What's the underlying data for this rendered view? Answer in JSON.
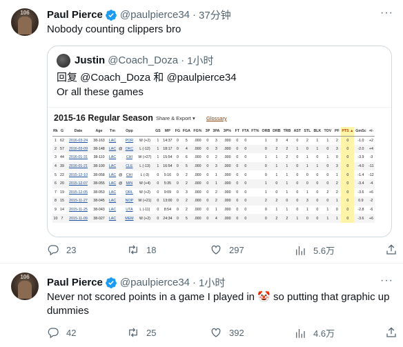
{
  "tweet1": {
    "avatar_text": "106",
    "name": "Paul Pierce",
    "handle": "@paulpierce34",
    "time": "37分钟",
    "text": "Nobody counting clippers bro",
    "quote": {
      "name": "Justin",
      "handle": "@Coach_Doza",
      "time": "1小时",
      "reply_line": "回复 @Coach_Doza 和 @paulpierce34",
      "text": "Or all these games",
      "image": {
        "title": "2015-16 Regular Season",
        "share_export": "Share & Export ▾",
        "glossary": "Glossary",
        "headers": [
          "Rk",
          "G",
          "Date",
          "Age",
          "Tm",
          "",
          "Opp",
          "",
          "GS",
          "MP",
          "FG",
          "FGA",
          "FG%",
          "3P",
          "3PA",
          "3P%",
          "FT",
          "FTA",
          "FT%",
          "ORB",
          "DRB",
          "TRB",
          "AST",
          "STL",
          "BLK",
          "TOV",
          "PF",
          "PTS ▲",
          "GmSc",
          "+/-"
        ],
        "rows": [
          [
            "1",
            "62",
            "2016-03-24",
            "38-163",
            "LAC",
            "",
            "POR",
            "W (+2)",
            "1",
            "14:37",
            "0",
            "5",
            ".000",
            "0",
            "3",
            ".000",
            "0",
            "0",
            "",
            "1",
            "3",
            "4",
            "0",
            "2",
            "1",
            "1",
            "2",
            "0",
            "-1.0",
            "+2"
          ],
          [
            "2",
            "57",
            "2016-03-09",
            "38-148",
            "LAC",
            "@",
            "OKC",
            "L (-12)",
            "1",
            "18:17",
            "0",
            "4",
            ".000",
            "0",
            "3",
            ".000",
            "0",
            "0",
            "",
            "0",
            "2",
            "2",
            "1",
            "0",
            "1",
            "0",
            "3",
            "0",
            "-2.0",
            "+4"
          ],
          [
            "3",
            "44",
            "2016-01-31",
            "38-110",
            "LAC",
            "",
            "CHI",
            "W (+27)",
            "1",
            "15:54",
            "0",
            "6",
            ".000",
            "0",
            "2",
            ".000",
            "0",
            "0",
            "",
            "1",
            "1",
            "2",
            "0",
            "1",
            "0",
            "1",
            "0",
            "0",
            "-3.9",
            "-3"
          ],
          [
            "4",
            "39",
            "2016-01-21",
            "38-100",
            "LAC",
            "",
            "CLE",
            "L (-13)",
            "1",
            "16:54",
            "0",
            "5",
            ".000",
            "0",
            "3",
            ".000",
            "0",
            "0",
            "",
            "0",
            "1",
            "1",
            "0",
            "1",
            "1",
            "0",
            "3",
            "0",
            "-4.0",
            "-11"
          ],
          [
            "5",
            "22",
            "2015-12-10",
            "38-058",
            "LAC",
            "@",
            "CHI",
            "L (-3)",
            "0",
            "5:16",
            "0",
            "2",
            ".000",
            "0",
            "1",
            ".000",
            "0",
            "0",
            "",
            "0",
            "1",
            "1",
            "0",
            "0",
            "0",
            "0",
            "1",
            "0",
            "-1.4",
            "-12"
          ],
          [
            "6",
            "20",
            "2015-12-07",
            "38-055",
            "LAC",
            "@",
            "MIN",
            "W (+4)",
            "0",
            "5:35",
            "0",
            "2",
            ".000",
            "0",
            "1",
            ".000",
            "0",
            "0",
            "",
            "1",
            "0",
            "1",
            "0",
            "0",
            "0",
            "0",
            "2",
            "0",
            "-3.4",
            "-4"
          ],
          [
            "7",
            "19",
            "2015-12-05",
            "38-053",
            "LAC",
            "",
            "ORL",
            "W (+2)",
            "0",
            "9:09",
            "0",
            "3",
            ".000",
            "0",
            "2",
            ".000",
            "0",
            "0",
            "",
            "1",
            "0",
            "1",
            "0",
            "1",
            "0",
            "2",
            "2",
            "0",
            "-3.6",
            "+6"
          ],
          [
            "8",
            "15",
            "2015-11-27",
            "38-045",
            "LAC",
            "",
            "NOP",
            "W (+21)",
            "0",
            "13:00",
            "0",
            "2",
            ".000",
            "0",
            "2",
            ".000",
            "0",
            "0",
            "",
            "2",
            "2",
            "0",
            "0",
            "3",
            "0",
            "0",
            "1",
            "0",
            "0.9",
            "-2"
          ],
          [
            "9",
            "14",
            "2015-11-25",
            "38-043",
            "LAC",
            "",
            "UTA",
            "L (-11)",
            "0",
            "8:54",
            "0",
            "2",
            ".000",
            "0",
            "1",
            ".000",
            "0",
            "0",
            "",
            "0",
            "1",
            "1",
            "0",
            "1",
            "0",
            "1",
            "0",
            "0",
            "-2.8",
            "-6"
          ],
          [
            "10",
            "7",
            "2015-11-09",
            "38-027",
            "LAC",
            "",
            "MEM",
            "W (+2)",
            "0",
            "24:34",
            "0",
            "5",
            ".000",
            "0",
            "4",
            ".000",
            "0",
            "0",
            "",
            "0",
            "2",
            "2",
            "1",
            "0",
            "0",
            "1",
            "1",
            "0",
            "-3.6",
            "+6"
          ]
        ]
      }
    },
    "actions": {
      "replies": "23",
      "retweets": "18",
      "likes": "297",
      "views": "5.6万"
    }
  },
  "tweet2": {
    "avatar_text": "106",
    "name": "Paul Pierce",
    "handle": "@paulpierce34",
    "time": "1小时",
    "text_line1": "Never not scored points in a game I played in 🤡 so putting that graphic up",
    "text_line2": "dummies",
    "actions": {
      "replies": "42",
      "retweets": "25",
      "likes": "392",
      "views": "4.6万"
    }
  },
  "icons": {
    "verified": "verified-badge-icon",
    "reply": "reply-icon",
    "retweet": "retweet-icon",
    "like": "heart-icon",
    "views": "views-bar-chart-icon",
    "share": "share-icon"
  },
  "colors": {
    "text": "#0f1419",
    "secondary": "#536471",
    "verified": "#1d9bf0",
    "border": "#cfd9de"
  }
}
